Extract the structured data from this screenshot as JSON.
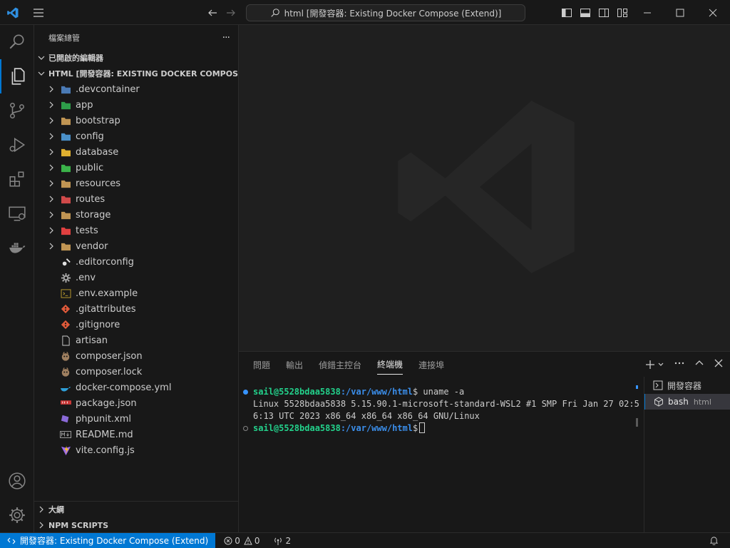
{
  "titlebar": {
    "search_text": "html [開發容器: Existing Docker Compose (Extend)]"
  },
  "sidebar": {
    "title": "檔案總管",
    "more": "···",
    "open_editors": "已開啟的編輯器",
    "workspace": "HTML [開發容器: EXISTING DOCKER COMPOSE (E...",
    "tree": [
      {
        "name": ".devcontainer",
        "folder": true,
        "icon": "devcontainer-folder-icon",
        "color": "#4a7ab5"
      },
      {
        "name": "app",
        "folder": true,
        "icon": "app-folder-icon",
        "color": "#2e9e4a"
      },
      {
        "name": "bootstrap",
        "folder": true,
        "icon": "folder-icon",
        "color": "#c09553"
      },
      {
        "name": "config",
        "folder": true,
        "icon": "config-folder-icon",
        "color": "#4a90c8"
      },
      {
        "name": "database",
        "folder": true,
        "icon": "database-folder-icon",
        "color": "#e0b030"
      },
      {
        "name": "public",
        "folder": true,
        "icon": "public-folder-icon",
        "color": "#3bb34a"
      },
      {
        "name": "resources",
        "folder": true,
        "icon": "folder-icon",
        "color": "#c09553"
      },
      {
        "name": "routes",
        "folder": true,
        "icon": "routes-folder-icon",
        "color": "#d04a4a"
      },
      {
        "name": "storage",
        "folder": true,
        "icon": "folder-icon",
        "color": "#c09553"
      },
      {
        "name": "tests",
        "folder": true,
        "icon": "tests-folder-icon",
        "color": "#e04040"
      },
      {
        "name": "vendor",
        "folder": true,
        "icon": "folder-icon",
        "color": "#c09553"
      },
      {
        "name": ".editorconfig",
        "folder": false,
        "icon": "editorconfig-icon",
        "color": "#e0e0e0"
      },
      {
        "name": ".env",
        "folder": false,
        "icon": "gear-icon",
        "color": "#b0b0b0"
      },
      {
        "name": ".env.example",
        "folder": false,
        "icon": "terminal-file-icon",
        "color": "#c0a030"
      },
      {
        "name": ".gitattributes",
        "folder": false,
        "icon": "git-icon",
        "color": "#e05a3a"
      },
      {
        "name": ".gitignore",
        "folder": false,
        "icon": "git-icon",
        "color": "#e05a3a"
      },
      {
        "name": "artisan",
        "folder": false,
        "icon": "file-icon",
        "color": "#cccccc"
      },
      {
        "name": "composer.json",
        "folder": false,
        "icon": "composer-icon",
        "color": "#a08060"
      },
      {
        "name": "composer.lock",
        "folder": false,
        "icon": "composer-icon",
        "color": "#a08060"
      },
      {
        "name": "docker-compose.yml",
        "folder": false,
        "icon": "docker-icon",
        "color": "#2e9fd8"
      },
      {
        "name": "package.json",
        "folder": false,
        "icon": "npm-icon",
        "color": "#cb3837"
      },
      {
        "name": "phpunit.xml",
        "folder": false,
        "icon": "xml-icon",
        "color": "#8a6ad8"
      },
      {
        "name": "README.md",
        "folder": false,
        "icon": "markdown-icon",
        "color": "#9a9a9a"
      },
      {
        "name": "vite.config.js",
        "folder": false,
        "icon": "vite-icon",
        "color": "#9a6af0"
      }
    ],
    "outline": "大綱",
    "npm_scripts": "NPM SCRIPTS"
  },
  "panel": {
    "tabs": [
      "問題",
      "輸出",
      "偵錯主控台",
      "終端機",
      "連接埠"
    ],
    "active_tab": "終端機"
  },
  "terminal": {
    "line1_user": "sail@5528bdaa5838",
    "line1_path": ":/var/www/html",
    "line1_cmd": "$ uname -a",
    "line2": "Linux 5528bdaa5838 5.15.90.1-microsoft-standard-WSL2 #1 SMP Fri Jan 27 02:5",
    "line3": "6:13 UTC 2023 x86_64 x86_64 x86_64 GNU/Linux",
    "line4_user": "sail@5528bdaa5838",
    "line4_path": ":/var/www/html",
    "line4_prompt": "$",
    "list": [
      {
        "label": "開發容器",
        "sub": ""
      },
      {
        "label": "bash",
        "sub": "html"
      }
    ]
  },
  "statusbar": {
    "remote": "開發容器: Existing Docker Compose (Extend)",
    "errors": "0",
    "warnings": "0",
    "ports": "2"
  },
  "colors": {
    "accent": "#0078d4",
    "success": "#23d18b",
    "path": "#3b8eea"
  }
}
